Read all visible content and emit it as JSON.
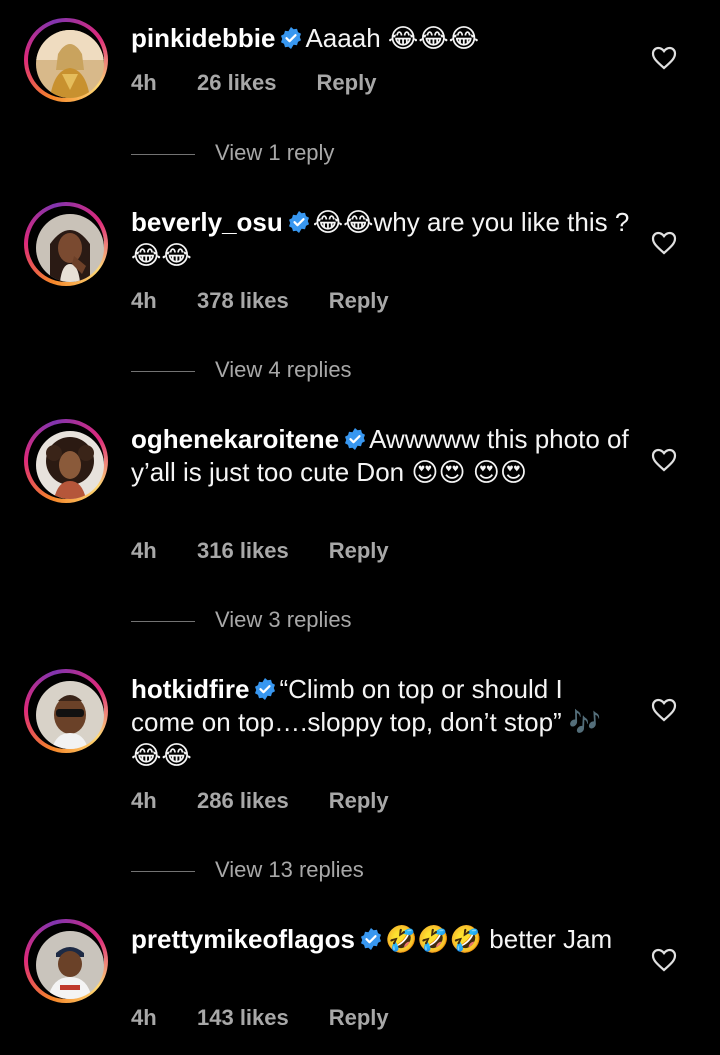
{
  "comments": [
    {
      "username": "pinkidebbie",
      "text": "Aaaah 😂😂😂",
      "time": "4h",
      "likes": "26 likes",
      "reply_label": "Reply",
      "view_replies": "View 1 reply",
      "avatar": "avatar-gold-outfit"
    },
    {
      "username": "beverly_osu",
      "text": "😂😂why are you like this ? 😂😂",
      "time": "4h",
      "likes": "378 likes",
      "reply_label": "Reply",
      "view_replies": "View 4 replies",
      "avatar": "avatar-braids-selfie"
    },
    {
      "username": "oghenekaroitene",
      "text": "Awwwww this photo of y’all is just too cute Don 😍😍 😍😍",
      "time": "4h",
      "likes": "316 likes",
      "reply_label": "Reply",
      "view_replies": "View 3 replies",
      "avatar": "avatar-curly-hair"
    },
    {
      "username": "hotkidfire",
      "text": "“Climb on top or should I come on top….sloppy top, don’t stop” 🎶😂😂",
      "time": "4h",
      "likes": "286 likes",
      "reply_label": "Reply",
      "view_replies": "View 13 replies",
      "avatar": "avatar-sunglasses"
    },
    {
      "username": "prettymikeoflagos",
      "text": "🤣🤣🤣 better Jam",
      "time": "4h",
      "likes": "143 likes",
      "reply_label": "Reply",
      "avatar": "avatar-gucci-shirt"
    }
  ],
  "icons": {
    "verified": "verified-badge-icon",
    "like": "heart-outline-icon"
  },
  "colors": {
    "background": "#000000",
    "verified_blue": "#3897f0",
    "secondary_text": "#a8a8a8"
  }
}
